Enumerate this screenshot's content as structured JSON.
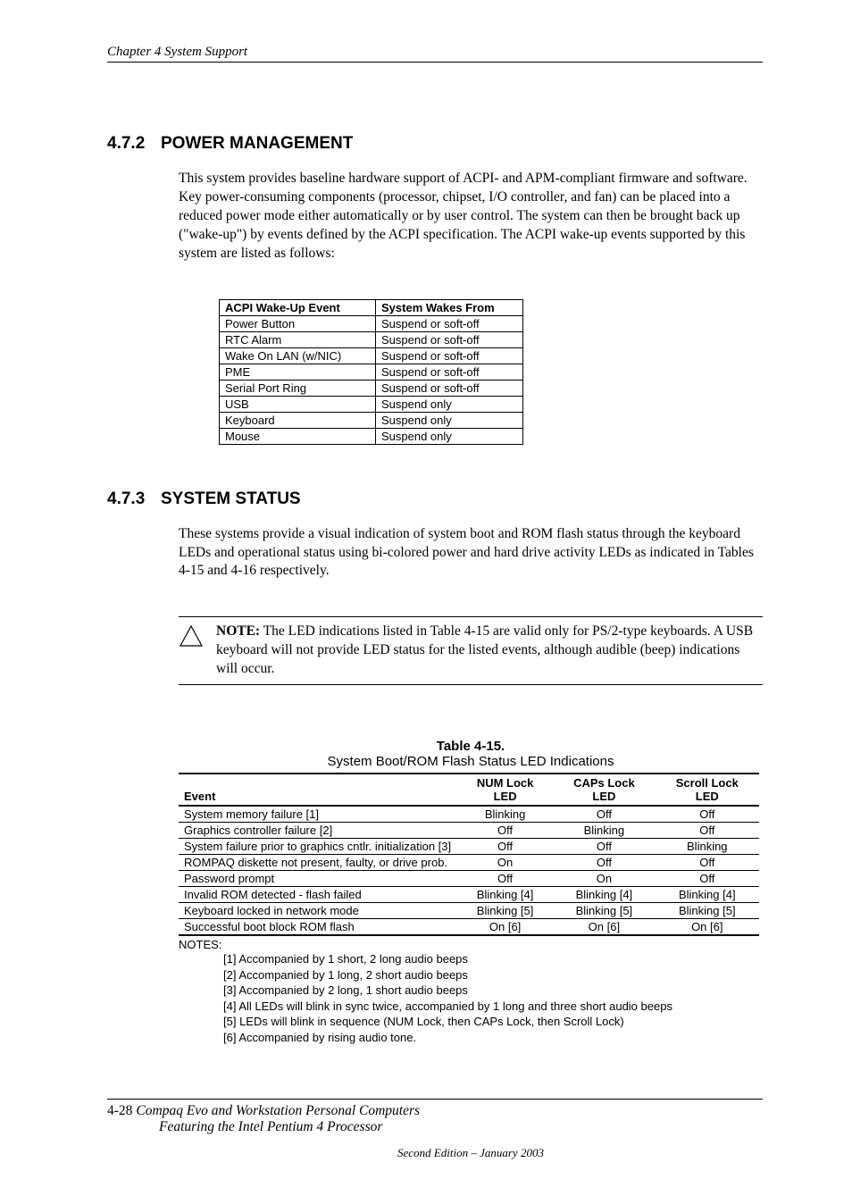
{
  "chapter_header": "Chapter 4  System Support",
  "section1": {
    "number": "4.7.2",
    "title": "POWER MANAGEMENT",
    "body": "This system provides baseline hardware support of ACPI- and APM-compliant firmware and software. Key power-consuming components (processor, chipset, I/O controller, and fan) can be placed into a reduced power mode either automatically or by user control. The system can then be brought back up (\"wake-up\") by events defined by the ACPI specification. The ACPI wake-up events supported by this system are listed as follows:"
  },
  "wake_table": {
    "headers": [
      "ACPI Wake-Up Event",
      "System Wakes From"
    ],
    "rows": [
      [
        "Power Button",
        "Suspend or soft-off"
      ],
      [
        "RTC Alarm",
        "Suspend or soft-off"
      ],
      [
        "Wake On LAN (w/NIC)",
        "Suspend or soft-off"
      ],
      [
        "PME",
        "Suspend or soft-off"
      ],
      [
        "Serial Port Ring",
        "Suspend or soft-off"
      ],
      [
        "USB",
        "Suspend only"
      ],
      [
        "Keyboard",
        "Suspend only"
      ],
      [
        "Mouse",
        "Suspend only"
      ]
    ]
  },
  "section2": {
    "number": "4.7.3",
    "title": "SYSTEM STATUS",
    "body": "These systems provide a visual indication of system boot and ROM flash status through the keyboard LEDs and operational status using bi-colored power and hard drive activity LEDs as indicated in Tables 4-15 and 4-16 respectively."
  },
  "note": {
    "label": "NOTE:",
    "text": "  The LED indications listed in Table 4-15 are valid only for PS/2-type keyboards. A USB keyboard will not provide LED status for the listed events, although audible (beep) indications will occur."
  },
  "led_table": {
    "label": "Table 4-15.",
    "subtitle": "System Boot/ROM Flash Status LED Indications",
    "headers": [
      "Event",
      "NUM Lock LED",
      "CAPs Lock LED",
      "Scroll Lock LED"
    ],
    "rows": [
      [
        "System memory failure [1]",
        "Blinking",
        "Off",
        "Off"
      ],
      [
        "Graphics controller failure [2]",
        "Off",
        "Blinking",
        "Off"
      ],
      [
        "System failure prior to graphics cntlr. initialization [3]",
        "Off",
        "Off",
        "Blinking"
      ],
      [
        "ROMPAQ diskette not present, faulty, or drive prob.",
        "On",
        "Off",
        "Off"
      ],
      [
        "Password prompt",
        "Off",
        "On",
        "Off"
      ],
      [
        "Invalid ROM detected - flash failed",
        "Blinking [4]",
        "Blinking [4]",
        "Blinking [4]"
      ],
      [
        "Keyboard locked in network mode",
        "Blinking [5]",
        "Blinking [5]",
        "Blinking [5]"
      ],
      [
        "Successful boot block ROM flash",
        "On [6]",
        "On [6]",
        "On [6]"
      ]
    ]
  },
  "notes": {
    "label": "NOTES:",
    "items": [
      "[1] Accompanied by 1 short, 2 long audio beeps",
      "[2] Accompanied by 1 long, 2 short audio beeps",
      "[3] Accompanied by 2 long, 1 short audio beeps",
      "[4] All LEDs will blink in sync twice, accompanied by 1 long and three short audio beeps",
      "[5] LEDs will blink in sequence (NUM Lock, then CAPs Lock, then Scroll Lock)",
      "[6] Accompanied by rising audio tone."
    ]
  },
  "footer": {
    "page": "4-28",
    "title": "Compaq Evo and Workstation Personal Computers",
    "subtitle": "Featuring the Intel Pentium 4 Processor",
    "edition": "Second Edition – January 2003"
  }
}
